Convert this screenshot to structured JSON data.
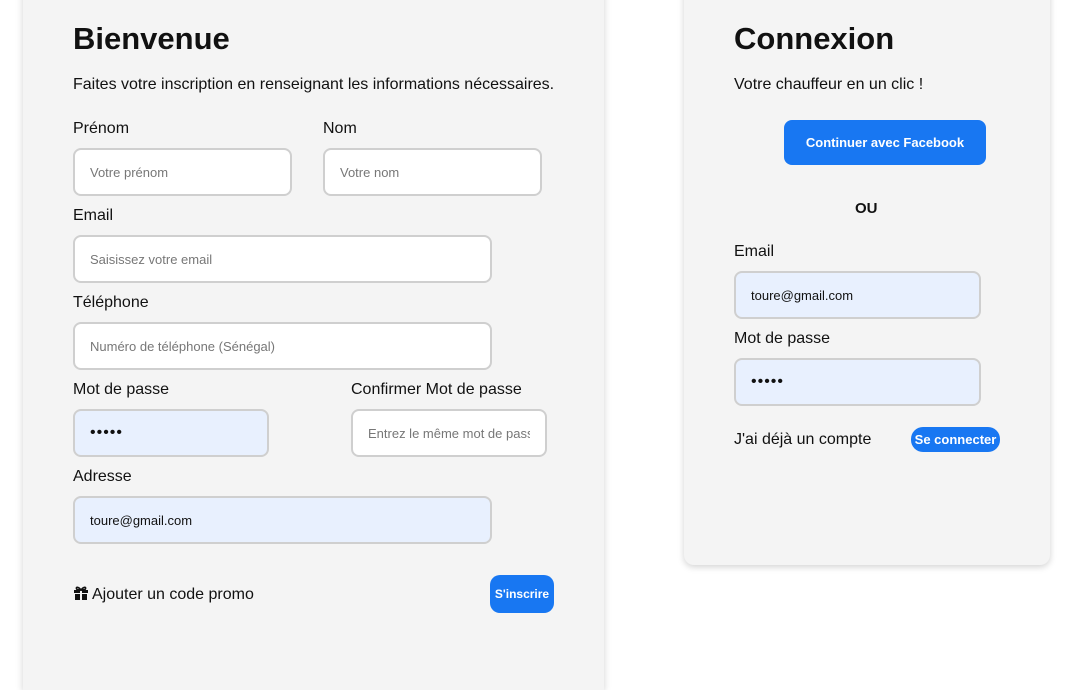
{
  "signup": {
    "title": "Bienvenue",
    "subtitle": "Faites votre inscription en renseignant les informations nécessaires.",
    "firstname": {
      "label": "Prénom",
      "placeholder": "Votre prénom",
      "value": ""
    },
    "lastname": {
      "label": "Nom",
      "placeholder": "Votre nom",
      "value": ""
    },
    "email": {
      "label": "Email",
      "placeholder": "Saisissez votre email",
      "value": ""
    },
    "phone": {
      "label": "Téléphone",
      "placeholder": "Numéro de téléphone (Sénégal)",
      "value": ""
    },
    "password": {
      "label": "Mot de passe",
      "value": "•••••"
    },
    "confirm": {
      "label": "Confirmer Mot de passe",
      "placeholder": "Entrez le même mot de passe",
      "value": ""
    },
    "address": {
      "label": "Adresse",
      "value": "toure@gmail.com"
    },
    "promo_label": "Ajouter un code promo",
    "submit_label": "S'inscrire"
  },
  "login": {
    "title": "Connexion",
    "subtitle": "Votre chauffeur en un clic !",
    "facebook_label": "Continuer avec Facebook",
    "or_label": "OU",
    "email": {
      "label": "Email",
      "value": "toure@gmail.com"
    },
    "password": {
      "label": "Mot de passe",
      "value": "•••••"
    },
    "account_text": "J'ai déjà un compte",
    "signin_label": "Se connecter"
  },
  "colors": {
    "primary": "#1877f2",
    "card_background": "#f4f4f4",
    "autofill_background": "#e8f0fe"
  },
  "icons": {
    "promo": "gift-icon"
  }
}
